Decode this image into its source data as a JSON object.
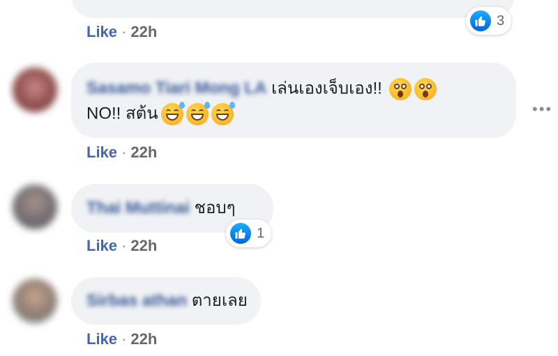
{
  "comments": [
    {
      "meta": {
        "like_label": "Like",
        "time": "22h"
      },
      "reaction": {
        "icon": "like-icon",
        "count": "3"
      }
    },
    {
      "name": "Sasamo Tiari Mong LA",
      "text_line1": "เล่นเองเจ็บเอง!!",
      "text_line2": "NO!! สต้น",
      "emojis_line1": [
        "astonished-face",
        "astonished-face"
      ],
      "emojis_line2": [
        "grinning-sweat-face",
        "grinning-sweat-face",
        "grinning-sweat-face"
      ],
      "meta": {
        "like_label": "Like",
        "time": "22h"
      }
    },
    {
      "name": "Thai Muttinai",
      "text": "ชอบๆ",
      "reaction": {
        "icon": "like-icon",
        "count": "1"
      },
      "meta": {
        "like_label": "Like",
        "time": "22h"
      }
    },
    {
      "name": "Sirbas athan",
      "text": "ตายเลย",
      "meta": {
        "like_label": "Like",
        "time": "22h"
      }
    }
  ],
  "more_options_label": "•••",
  "colors": {
    "bubble": "#f0f2f5",
    "link": "#4267b2",
    "like_badge": "#1877f2"
  }
}
